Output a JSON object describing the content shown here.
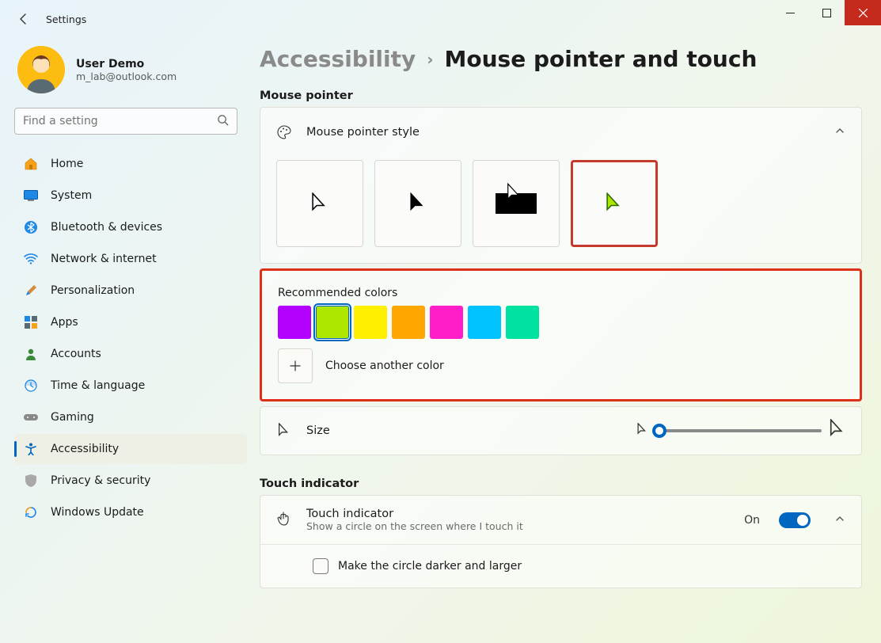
{
  "window": {
    "title": "Settings"
  },
  "profile": {
    "name": "User Demo",
    "email": "m_lab@outlook.com"
  },
  "search": {
    "placeholder": "Find a setting"
  },
  "nav": {
    "items": [
      {
        "label": "Home"
      },
      {
        "label": "System"
      },
      {
        "label": "Bluetooth & devices"
      },
      {
        "label": "Network & internet"
      },
      {
        "label": "Personalization"
      },
      {
        "label": "Apps"
      },
      {
        "label": "Accounts"
      },
      {
        "label": "Time & language"
      },
      {
        "label": "Gaming"
      },
      {
        "label": "Accessibility"
      },
      {
        "label": "Privacy & security"
      },
      {
        "label": "Windows Update"
      }
    ],
    "activeIndex": 9
  },
  "breadcrumb": {
    "parent": "Accessibility",
    "current": "Mouse pointer and touch"
  },
  "sections": {
    "pointer": {
      "heading": "Mouse pointer",
      "styleTitle": "Mouse pointer style",
      "selectedStyleIndex": 3,
      "recommendedTitle": "Recommended colors",
      "colors": [
        "#b400ff",
        "#aee600",
        "#ffef00",
        "#ffa600",
        "#ff1ec8",
        "#00c3ff",
        "#00e3a0"
      ],
      "selectedColorIndex": 1,
      "chooseAnother": "Choose another color",
      "sizeLabel": "Size"
    },
    "touch": {
      "heading": "Touch indicator",
      "rowTitle": "Touch indicator",
      "rowSub": "Show a circle on the screen where I touch it",
      "state": "On",
      "circleOption": "Make the circle darker and larger"
    }
  }
}
